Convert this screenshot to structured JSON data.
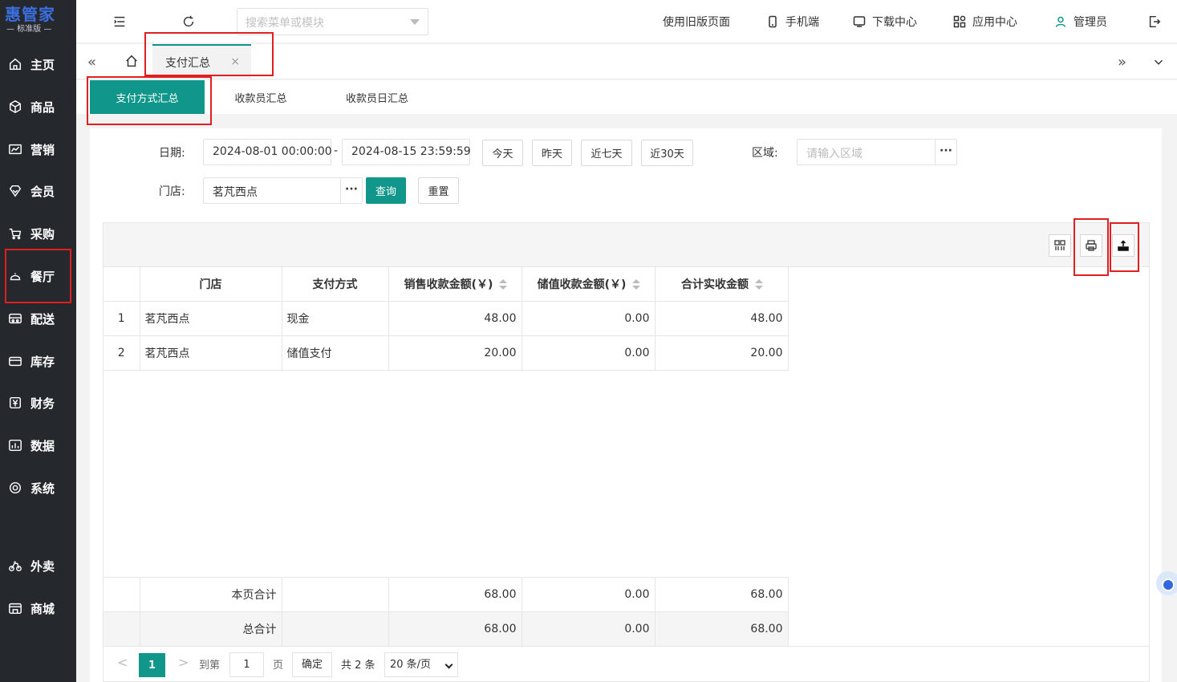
{
  "app": {
    "logo_main": "惠管家",
    "logo_sub": "— 标准版 —"
  },
  "sidebar": {
    "items": [
      {
        "label": "主页",
        "icon": "home-icon"
      },
      {
        "label": "商品",
        "icon": "cube-icon"
      },
      {
        "label": "营销",
        "icon": "chart-icon"
      },
      {
        "label": "会员",
        "icon": "diamond-icon"
      },
      {
        "label": "采购",
        "icon": "cart-icon"
      },
      {
        "label": "餐厅",
        "icon": "cloche-icon"
      },
      {
        "label": "配送",
        "icon": "truck-icon"
      },
      {
        "label": "库存",
        "icon": "box-icon"
      },
      {
        "label": "财务",
        "icon": "yen-icon"
      },
      {
        "label": "数据",
        "icon": "bar-chart-icon"
      },
      {
        "label": "系统",
        "icon": "target-icon"
      },
      {
        "label": "外卖",
        "icon": "bike-icon"
      },
      {
        "label": "商城",
        "icon": "store-icon"
      }
    ]
  },
  "header": {
    "search_placeholder": "搜索菜单或模块",
    "links": {
      "old_page": "使用旧版页面",
      "mobile": "手机端",
      "download": "下载中心",
      "apps": "应用中心",
      "user": "管理员"
    }
  },
  "tabs": {
    "active": "支付汇总",
    "close": "×"
  },
  "subtabs": [
    "支付方式汇总",
    "收款员汇总",
    "收款员日汇总"
  ],
  "filters": {
    "date_label": "日期:",
    "date_from": "2024-08-01 00:00:00",
    "date_sep": "-",
    "date_to": "2024-08-15 23:59:59",
    "quick": [
      "今天",
      "昨天",
      "近七天",
      "近30天"
    ],
    "region_label": "区域:",
    "region_placeholder": "请输入区域",
    "store_label": "门店:",
    "store_value": "茗芃西点",
    "more": "···",
    "query": "查询",
    "reset": "重置"
  },
  "table": {
    "headers": [
      "门店",
      "支付方式",
      "销售收款金额(￥)",
      "储值收款金额(￥)",
      "合计实收金额"
    ],
    "rows": [
      {
        "idx": "1",
        "store": "茗芃西点",
        "method": "现金",
        "sales": "48.00",
        "stored": "0.00",
        "total": "48.00"
      },
      {
        "idx": "2",
        "store": "茗芃西点",
        "method": "储值支付",
        "sales": "20.00",
        "stored": "0.00",
        "total": "20.00"
      }
    ],
    "page_total": {
      "label": "本页合计",
      "sales": "68.00",
      "stored": "0.00",
      "total": "68.00"
    },
    "grand_total": {
      "label": "总合计",
      "sales": "68.00",
      "stored": "0.00",
      "total": "68.00"
    }
  },
  "pager": {
    "prev": "<",
    "current": "1",
    "next": ">",
    "goto": "到第",
    "goto_value": "1",
    "page_unit": "页",
    "confirm": "确定",
    "total": "共 2 条",
    "page_size": "20 条/页"
  },
  "colors": {
    "accent": "#10968a",
    "sidebar": "#25282d",
    "highlight": "#e02020"
  }
}
